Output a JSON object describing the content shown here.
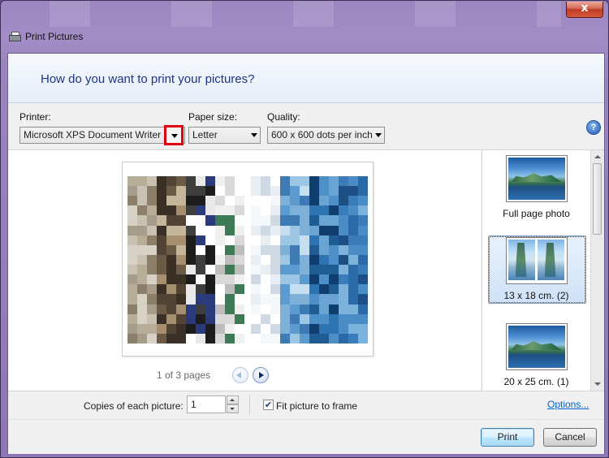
{
  "window": {
    "title": "Print Pictures",
    "close_glyph": "x"
  },
  "header": {
    "question": "How do you want to print your pictures?"
  },
  "options": {
    "printer_label": "Printer:",
    "printer_value": "Microsoft XPS Document Writer",
    "paper_label": "Paper size:",
    "paper_value": "Letter",
    "quality_label": "Quality:",
    "quality_value": "600 x 600 dots per inch",
    "help_glyph": "?"
  },
  "preview": {
    "pager_text": "1 of 3 pages"
  },
  "layouts": {
    "items": [
      {
        "label": "Full page photo",
        "selected": false
      },
      {
        "label": "13 x 18 cm. (2)",
        "selected": true
      },
      {
        "label": "20 x 25 cm. (1)",
        "selected": false
      }
    ]
  },
  "bottom": {
    "copies_label": "Copies of each picture:",
    "copies_value": "1",
    "fit_label": "Fit picture to frame",
    "fit_checked": true,
    "check_glyph": "✔",
    "options_link": "Options..."
  },
  "buttons": {
    "print": "Print",
    "cancel": "Cancel"
  },
  "icons": {
    "printer": "printer-icon",
    "help": "help-icon",
    "prev": "previous-page-icon",
    "next": "next-page-icon",
    "dropdown": "chevron-down-icon"
  }
}
